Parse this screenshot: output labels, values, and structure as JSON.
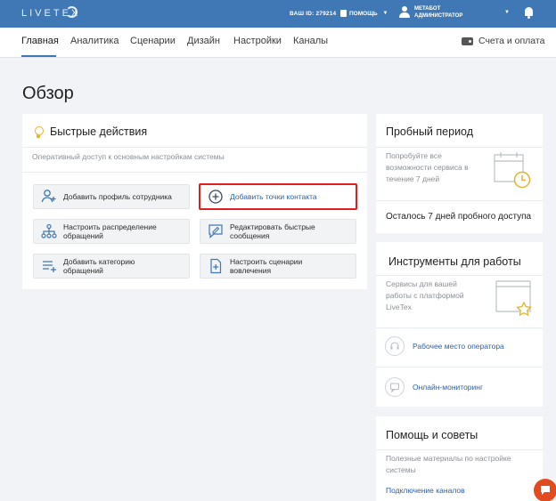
{
  "topbar": {
    "logo": "LIVETEX",
    "account_id": "ВАШ ID: 279214",
    "help_label": "ПОМОЩЬ",
    "user_name": "МЕТАБОТ",
    "user_role": "АДМИНИСТРАТОР"
  },
  "nav": {
    "items": [
      {
        "label": "Главная"
      },
      {
        "label": "Аналитика"
      },
      {
        "label": "Сценарии"
      },
      {
        "label": "Дизайн"
      },
      {
        "label": "Настройки"
      },
      {
        "label": "Каналы"
      }
    ],
    "billing_label": "Счета и оплата"
  },
  "page": {
    "title": "Обзор"
  },
  "quick_actions": {
    "title": "Быстрые действия",
    "description": "Оперативный доступ к основным настройкам системы",
    "buttons": [
      {
        "label": "Добавить профиль сотрудника",
        "icon": "add-user-icon"
      },
      {
        "label": "Добавить точки контакта",
        "icon": "plus-circle-icon"
      },
      {
        "label": "Настроить распределение обращений",
        "icon": "hierarchy-icon"
      },
      {
        "label": "Редактировать быстрые сообщения",
        "icon": "message-edit-icon"
      },
      {
        "label": "Добавить категорию обращений",
        "icon": "list-add-icon"
      },
      {
        "label": "Настроить сценарии вовлечения",
        "icon": "document-add-icon"
      }
    ]
  },
  "trial": {
    "title": "Пробный период",
    "description": "Попробуйте все возможности сервиса в течение 7 дней",
    "remaining": "Осталось 7 дней пробного доступа"
  },
  "tools": {
    "title": "Инструменты для работы",
    "description": "Сервисы для вашей работы с платформой LiveTex",
    "items": [
      {
        "label": "Рабочее место оператора",
        "icon": "headset-icon"
      },
      {
        "label": "Онлайн-мониторинг",
        "icon": "chat-monitor-icon"
      }
    ]
  },
  "help": {
    "title": "Помощь и советы",
    "description": "Полезные материалы по настройке системы",
    "link": "Подключение каналов"
  },
  "colors": {
    "topbar": "#3f78b4",
    "link": "#2a62a8",
    "highlight_border": "#e02020",
    "chat_button": "#e24a1f"
  }
}
